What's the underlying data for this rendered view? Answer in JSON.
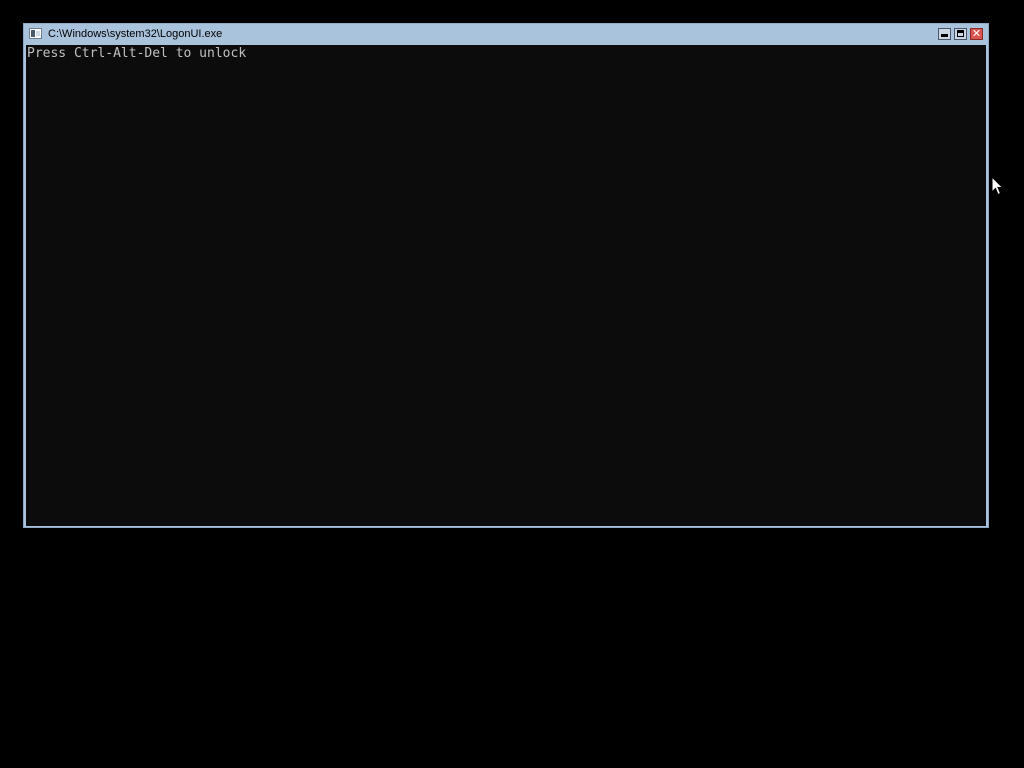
{
  "window": {
    "title": "C:\\Windows\\system32\\LogonUI.exe",
    "icon": "console-app-icon",
    "controls": {
      "minimize_icon": "minimize-icon",
      "maximize_icon": "maximize-icon",
      "close_icon": "close-icon",
      "close_glyph": "✕"
    }
  },
  "console": {
    "lines": [
      "Press Ctrl-Alt-Del to unlock"
    ],
    "text_color": "#c0c0c0",
    "background_color": "#0c0c0c"
  },
  "colors": {
    "desktop_background": "#000000",
    "window_frame": "#a9c3dc",
    "close_button": "#d9534f"
  },
  "pointer": {
    "icon": "mouse-pointer-icon"
  }
}
